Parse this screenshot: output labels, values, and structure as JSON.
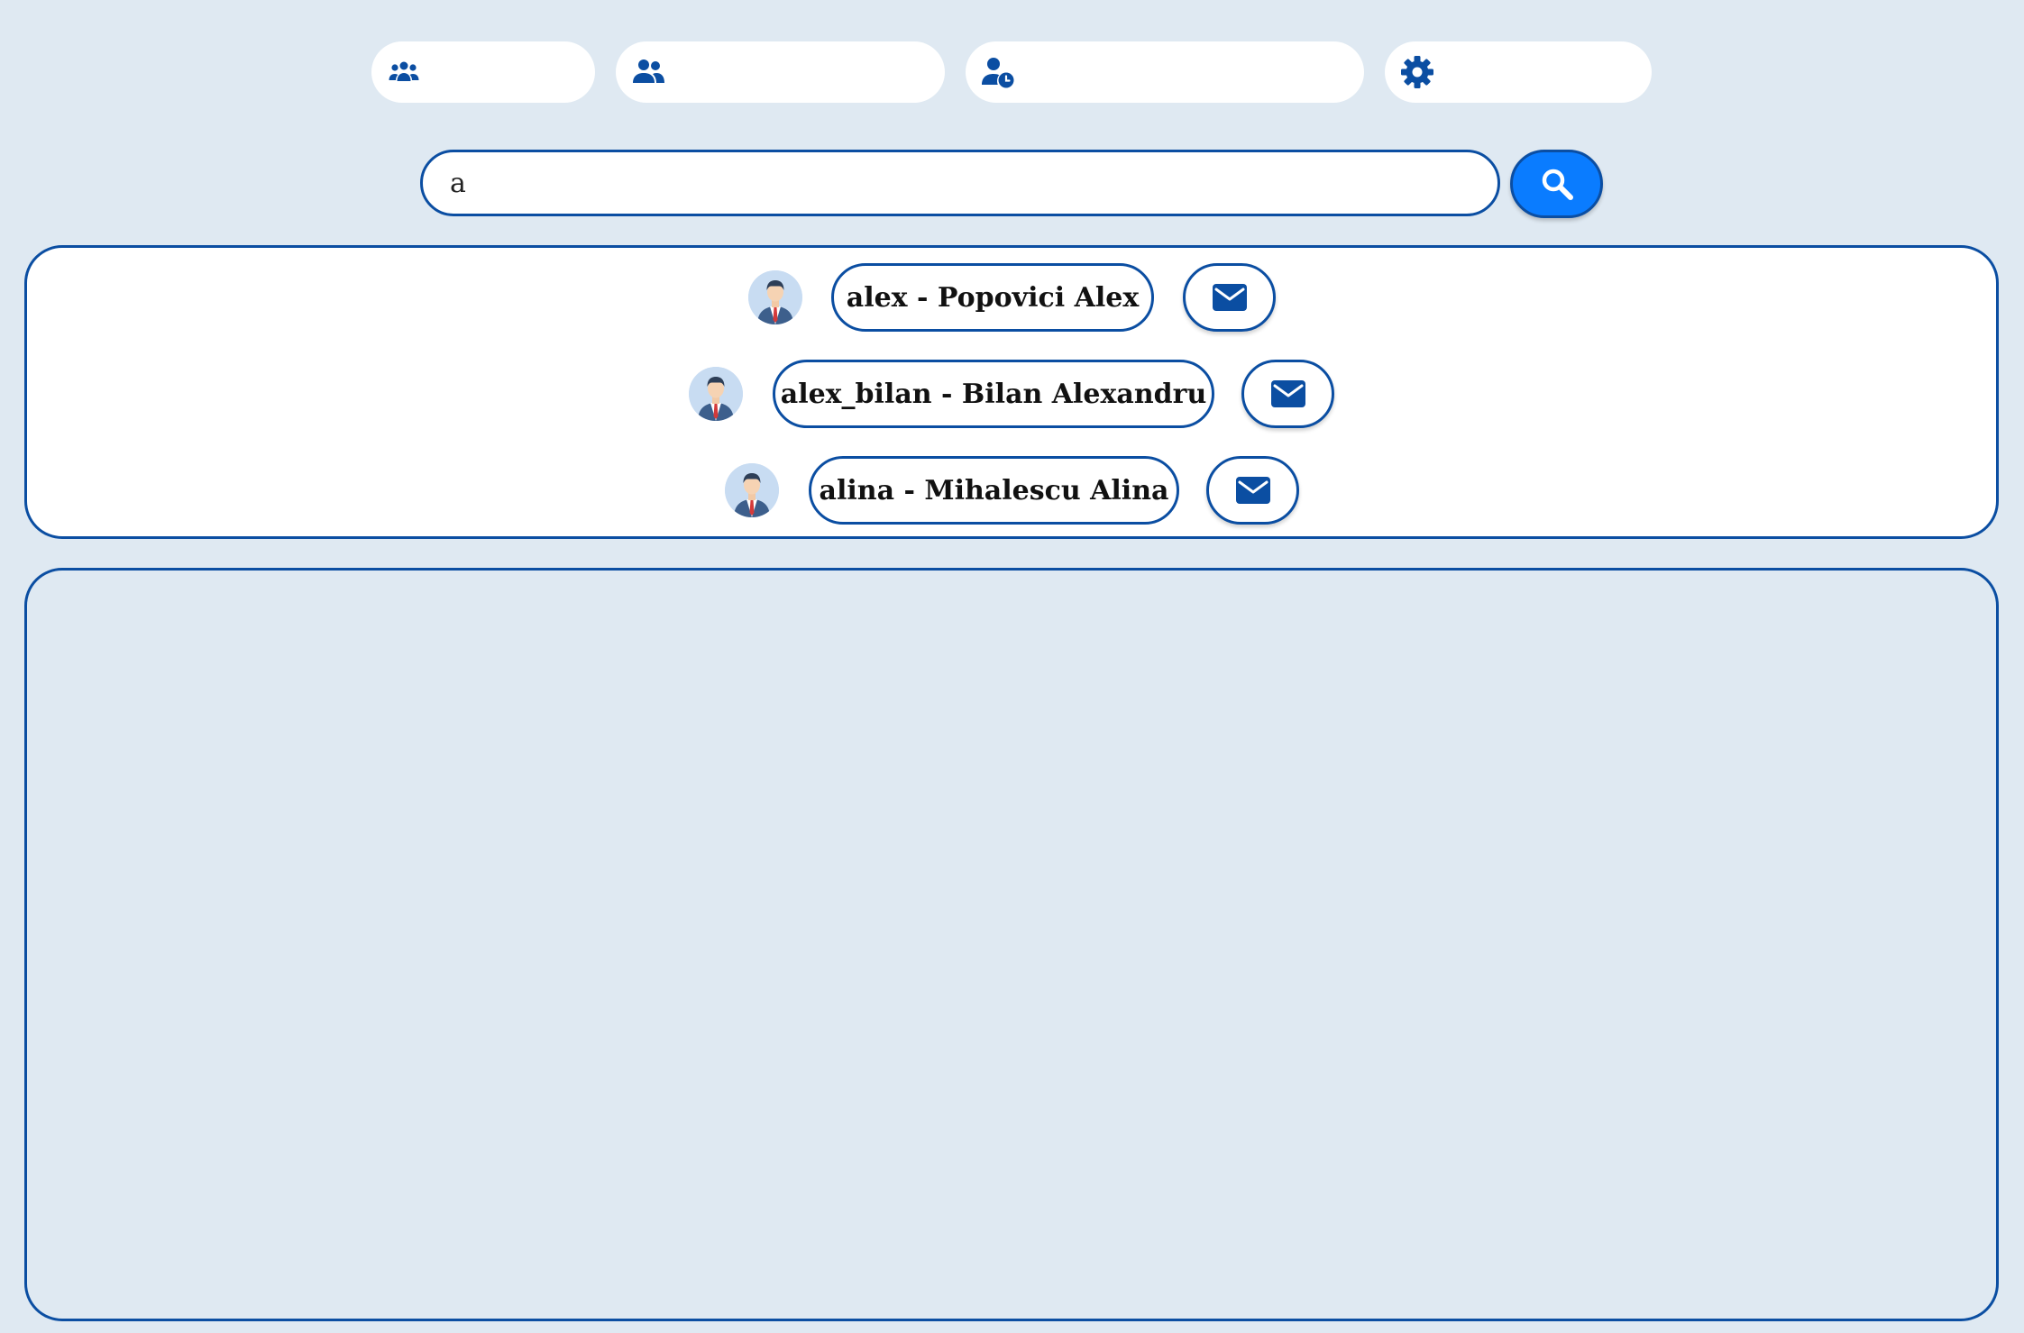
{
  "nav": {
    "items": [
      {
        "icon": "users-group-icon",
        "label": ""
      },
      {
        "icon": "user-friends-icon",
        "label": ""
      },
      {
        "icon": "user-clock-icon",
        "label": ""
      },
      {
        "icon": "gear-icon",
        "label": ""
      }
    ]
  },
  "search": {
    "value": "a",
    "placeholder": "",
    "button_icon": "search-icon"
  },
  "results": [
    {
      "label": "alex - Popovici Alex",
      "avatar_icon": "user-avatar-icon",
      "action_icon": "envelope-icon"
    },
    {
      "label": "alex_bilan - Bilan Alexandru",
      "avatar_icon": "user-avatar-icon",
      "action_icon": "envelope-icon"
    },
    {
      "label": "alina - Mihalescu Alina",
      "avatar_icon": "user-avatar-icon",
      "action_icon": "envelope-icon"
    }
  ],
  "colors": {
    "background": "#dfe9f2",
    "border": "#0b4ea2",
    "accent": "#0a7cff",
    "icon": "#0b4ea2"
  }
}
